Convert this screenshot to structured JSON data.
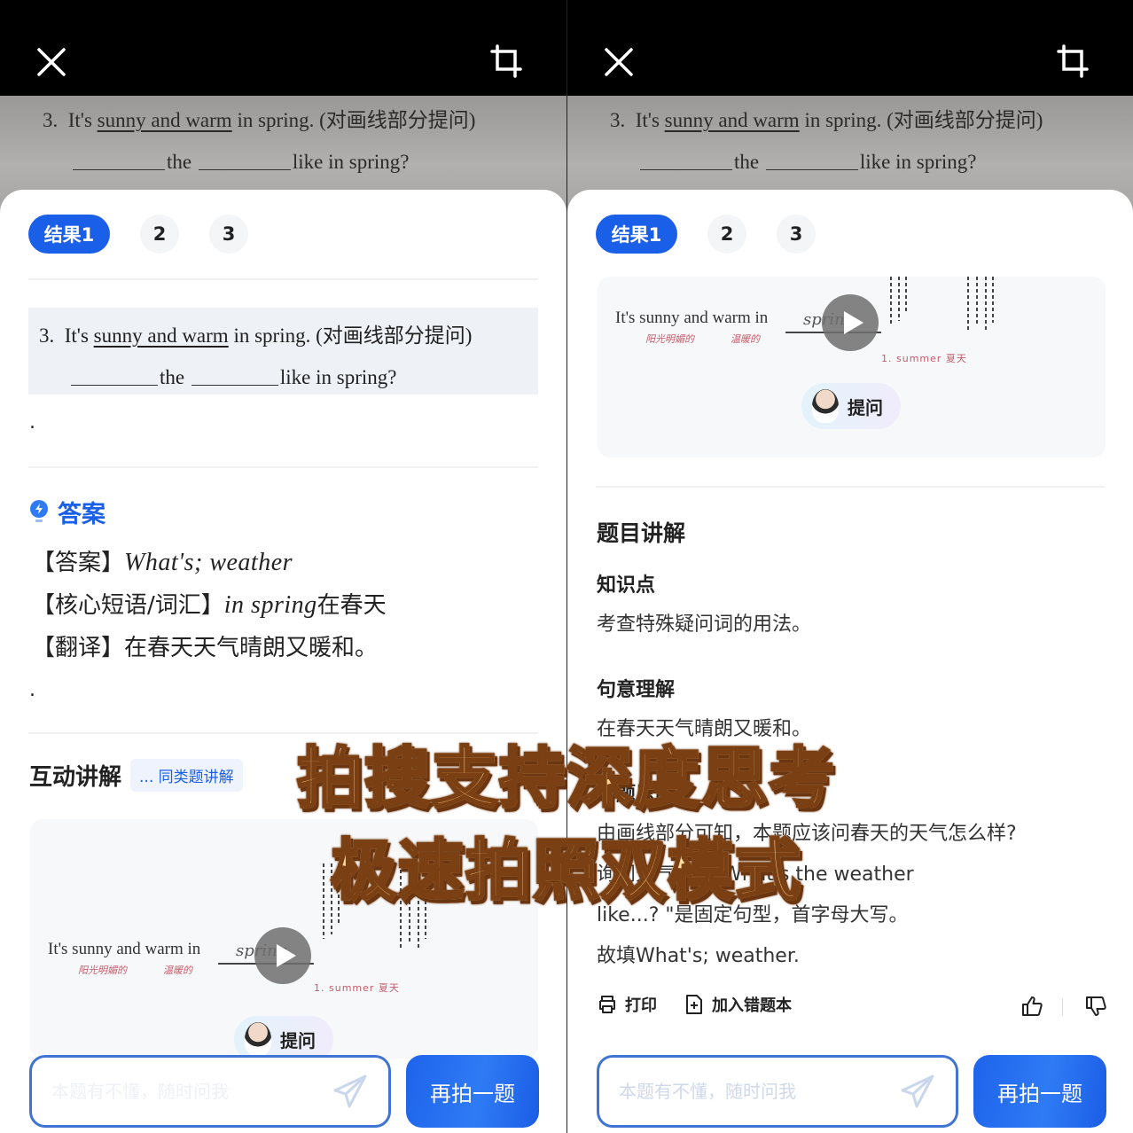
{
  "panels": [
    {
      "photo": {
        "number": "3.",
        "pre": "It's",
        "underlined": "sunny and warm",
        "post": "in spring.",
        "instruction": "(对画线部分提问)",
        "line2_mid": "the",
        "line2_end": "like in spring?"
      },
      "tabs": [
        "结果1",
        "2",
        "3"
      ],
      "question": {
        "number": "3.",
        "pre": "It's",
        "underlined": "sunny and warm",
        "post": "in spring.",
        "instruction": "(对画线部分提问)",
        "line2_mid": "the",
        "line2_end": "like in spring?",
        "trailing_dot": "."
      },
      "answer": {
        "title": "答案",
        "lines": [
          {
            "label": "【答案】",
            "value": "What's;  weather",
            "suffix": ""
          },
          {
            "label": "【核心短语/词汇】",
            "value": "in  spring",
            "suffix": "在春天"
          },
          {
            "label": "【翻译】",
            "value": "",
            "suffix": "在春天天气晴朗又暖和。"
          }
        ],
        "trailing_dot": "."
      },
      "interactive": {
        "title": "互动讲解",
        "similar_link": "... 同类题讲解"
      },
      "video": {
        "sentence": "It's sunny and warm in",
        "blank_word": "spring",
        "note1": "阳光明媚的",
        "note2": "温暖的",
        "note3": "1. summer  夏天",
        "ask_label": "提问"
      },
      "input": {
        "placeholder": "本题有不懂，随时问我",
        "value": ""
      },
      "retake_label": "再拍一题"
    },
    {
      "photo": {
        "number": "3.",
        "pre": "It's",
        "underlined": "sunny and warm",
        "post": "in spring.",
        "instruction": "(对画线部分提问)",
        "line2_mid": "the",
        "line2_end": "like in spring?"
      },
      "tabs": [
        "结果1",
        "2",
        "3"
      ],
      "video": {
        "sentence": "It's sunny and warm in",
        "blank_word": "spring",
        "note1": "阳光明媚的",
        "note2": "温暖的",
        "note3": "1. summer  夏天",
        "ask_label": "提问"
      },
      "explanation": {
        "title": "题目讲解",
        "knowledge_title": "知识点",
        "knowledge_text": "考查特殊疑问词的用法。",
        "meaning_title": "句意理解",
        "meaning_text": "在春天天气晴朗又暖和。",
        "approach_title": "解题思路",
        "approach_lines": [
          "由画线部分可知，本题应该问春天的天气怎么样?",
          "询问天气时，\"What's the weather",
          "like...? \"是固定句型，首字母大写。",
          "故填What's; weather."
        ]
      },
      "actions": {
        "print": "打印",
        "add_to_mistakes": "加入错题本"
      },
      "input": {
        "placeholder": "本题有不懂，随时问我",
        "value": ""
      },
      "retake_label": "再拍一题"
    }
  ],
  "banner": {
    "line1": "拍搜支持深度思考",
    "line2": "极速拍照双模式"
  },
  "colors": {
    "accent": "#1a5fe8",
    "banner_fill": "#f2b25a",
    "banner_stroke": "#7a3f12"
  }
}
